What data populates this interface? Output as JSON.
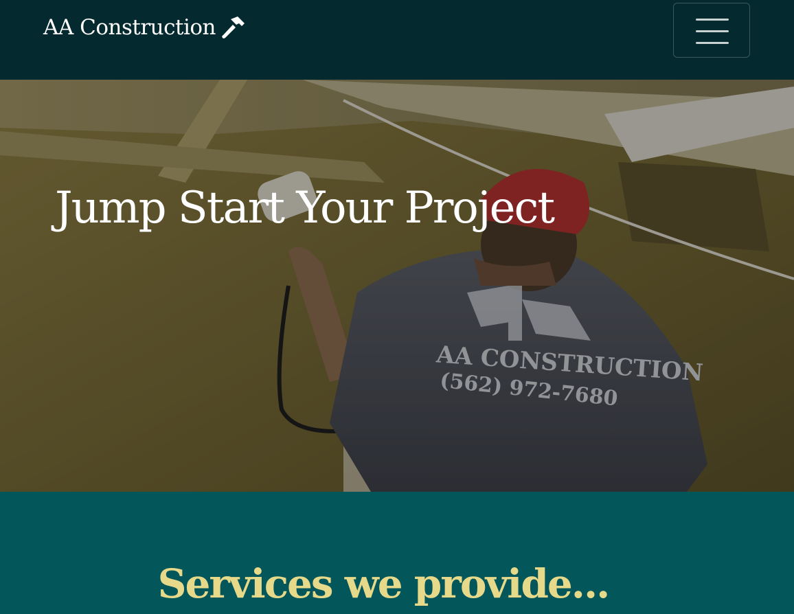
{
  "navbar": {
    "brand": "AA Construction",
    "brand_icon": "hammer-icon",
    "toggler_icon": "hamburger-menu-icon"
  },
  "hero": {
    "title": "Jump Start Your Project",
    "shirt_logo_text": "AA CONSTRUCTION",
    "shirt_phone": "(562) 972-7680"
  },
  "services": {
    "title": "Services we provide..."
  },
  "colors": {
    "navbar_bg": "#04292e",
    "section_bg": "#03565a",
    "heading_accent": "#e7d98a",
    "text": "#ffffff"
  }
}
